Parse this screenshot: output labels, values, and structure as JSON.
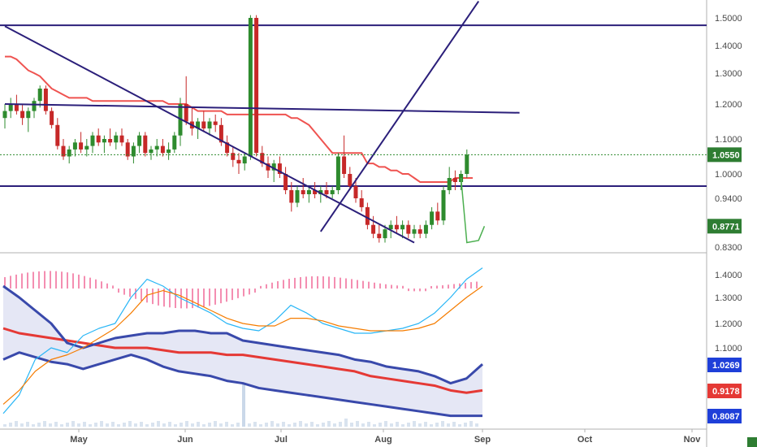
{
  "chart_data": {
    "type": "candlestick",
    "x_tick_labels": [
      "May",
      "Jun",
      "Jul",
      "Aug",
      "Sep",
      "Oct",
      "Nov"
    ],
    "main_panel": {
      "y_tick_labels": [
        "1.5000",
        "1.4000",
        "1.3000",
        "1.2000",
        "1.1000",
        "1.0000",
        "0.9400",
        "0.8300"
      ],
      "last_price": "1.0550",
      "green_line_value": "0.8771",
      "colors": {
        "up": "#2e8b2e",
        "down": "#c62828",
        "line": "#2b1f7a",
        "red_line": "#ef5350",
        "green_line": "#4caf50"
      },
      "series": [
        {
          "name": "",
          "kind": "ohlc",
          "values": [
            {
              "o": 1.16,
              "h": 1.2,
              "l": 1.13,
              "c": 1.18
            },
            {
              "o": 1.18,
              "h": 1.22,
              "l": 1.16,
              "c": 1.2
            },
            {
              "o": 1.2,
              "h": 1.23,
              "l": 1.17,
              "c": 1.18
            },
            {
              "o": 1.18,
              "h": 1.2,
              "l": 1.14,
              "c": 1.16
            },
            {
              "o": 1.16,
              "h": 1.19,
              "l": 1.12,
              "c": 1.18
            },
            {
              "o": 1.18,
              "h": 1.22,
              "l": 1.16,
              "c": 1.21
            },
            {
              "o": 1.21,
              "h": 1.26,
              "l": 1.19,
              "c": 1.25
            },
            {
              "o": 1.25,
              "h": 1.26,
              "l": 1.17,
              "c": 1.18
            },
            {
              "o": 1.18,
              "h": 1.19,
              "l": 1.13,
              "c": 1.14
            },
            {
              "o": 1.14,
              "h": 1.16,
              "l": 1.07,
              "c": 1.08
            },
            {
              "o": 1.08,
              "h": 1.1,
              "l": 1.04,
              "c": 1.05
            },
            {
              "o": 1.05,
              "h": 1.08,
              "l": 1.03,
              "c": 1.07
            },
            {
              "o": 1.07,
              "h": 1.1,
              "l": 1.05,
              "c": 1.09
            },
            {
              "o": 1.09,
              "h": 1.12,
              "l": 1.06,
              "c": 1.07
            },
            {
              "o": 1.07,
              "h": 1.1,
              "l": 1.05,
              "c": 1.08
            },
            {
              "o": 1.08,
              "h": 1.12,
              "l": 1.06,
              "c": 1.11
            },
            {
              "o": 1.11,
              "h": 1.13,
              "l": 1.08,
              "c": 1.09
            },
            {
              "o": 1.09,
              "h": 1.11,
              "l": 1.06,
              "c": 1.1
            },
            {
              "o": 1.1,
              "h": 1.13,
              "l": 1.08,
              "c": 1.09
            },
            {
              "o": 1.09,
              "h": 1.12,
              "l": 1.07,
              "c": 1.11
            },
            {
              "o": 1.11,
              "h": 1.13,
              "l": 1.08,
              "c": 1.09
            },
            {
              "o": 1.09,
              "h": 1.1,
              "l": 1.04,
              "c": 1.05
            },
            {
              "o": 1.05,
              "h": 1.09,
              "l": 1.03,
              "c": 1.08
            },
            {
              "o": 1.08,
              "h": 1.12,
              "l": 1.06,
              "c": 1.11
            },
            {
              "o": 1.11,
              "h": 1.12,
              "l": 1.05,
              "c": 1.06
            },
            {
              "o": 1.06,
              "h": 1.08,
              "l": 1.04,
              "c": 1.07
            },
            {
              "o": 1.07,
              "h": 1.1,
              "l": 1.05,
              "c": 1.08
            },
            {
              "o": 1.08,
              "h": 1.1,
              "l": 1.05,
              "c": 1.06
            },
            {
              "o": 1.06,
              "h": 1.09,
              "l": 1.04,
              "c": 1.07
            },
            {
              "o": 1.07,
              "h": 1.12,
              "l": 1.06,
              "c": 1.11
            },
            {
              "o": 1.11,
              "h": 1.22,
              "l": 1.08,
              "c": 1.2
            },
            {
              "o": 1.2,
              "h": 1.29,
              "l": 1.14,
              "c": 1.15
            },
            {
              "o": 1.15,
              "h": 1.19,
              "l": 1.11,
              "c": 1.13
            },
            {
              "o": 1.13,
              "h": 1.16,
              "l": 1.1,
              "c": 1.15
            },
            {
              "o": 1.15,
              "h": 1.18,
              "l": 1.12,
              "c": 1.13
            },
            {
              "o": 1.13,
              "h": 1.16,
              "l": 1.11,
              "c": 1.15
            },
            {
              "o": 1.15,
              "h": 1.17,
              "l": 1.12,
              "c": 1.14
            },
            {
              "o": 1.14,
              "h": 1.16,
              "l": 1.08,
              "c": 1.09
            },
            {
              "o": 1.09,
              "h": 1.11,
              "l": 1.05,
              "c": 1.06
            },
            {
              "o": 1.06,
              "h": 1.08,
              "l": 1.02,
              "c": 1.04
            },
            {
              "o": 1.04,
              "h": 1.06,
              "l": 1.0,
              "c": 1.03
            },
            {
              "o": 1.03,
              "h": 1.06,
              "l": 1.01,
              "c": 1.05
            },
            {
              "o": 1.05,
              "h": 1.51,
              "l": 1.04,
              "c": 1.5
            },
            {
              "o": 1.5,
              "h": 1.51,
              "l": 1.05,
              "c": 1.06
            },
            {
              "o": 1.06,
              "h": 1.08,
              "l": 1.02,
              "c": 1.03
            },
            {
              "o": 1.03,
              "h": 1.05,
              "l": 0.99,
              "c": 1.01
            },
            {
              "o": 1.01,
              "h": 1.04,
              "l": 0.98,
              "c": 1.03
            },
            {
              "o": 1.03,
              "h": 1.05,
              "l": 0.99,
              "c": 1.0
            },
            {
              "o": 1.0,
              "h": 1.02,
              "l": 0.95,
              "c": 0.96
            },
            {
              "o": 0.96,
              "h": 0.98,
              "l": 0.91,
              "c": 0.93
            },
            {
              "o": 0.93,
              "h": 0.97,
              "l": 0.92,
              "c": 0.96
            },
            {
              "o": 0.96,
              "h": 0.99,
              "l": 0.94,
              "c": 0.95
            },
            {
              "o": 0.95,
              "h": 0.97,
              "l": 0.93,
              "c": 0.96
            },
            {
              "o": 0.96,
              "h": 0.98,
              "l": 0.94,
              "c": 0.95
            },
            {
              "o": 0.95,
              "h": 0.97,
              "l": 0.93,
              "c": 0.96
            },
            {
              "o": 0.96,
              "h": 0.98,
              "l": 0.94,
              "c": 0.95
            },
            {
              "o": 0.95,
              "h": 0.97,
              "l": 0.94,
              "c": 0.96
            },
            {
              "o": 0.96,
              "h": 1.06,
              "l": 0.95,
              "c": 1.05
            },
            {
              "o": 1.05,
              "h": 1.11,
              "l": 0.99,
              "c": 1.0
            },
            {
              "o": 1.0,
              "h": 1.02,
              "l": 0.96,
              "c": 0.97
            },
            {
              "o": 0.97,
              "h": 0.99,
              "l": 0.93,
              "c": 0.94
            },
            {
              "o": 0.94,
              "h": 0.96,
              "l": 0.91,
              "c": 0.92
            },
            {
              "o": 0.92,
              "h": 0.93,
              "l": 0.87,
              "c": 0.88
            },
            {
              "o": 0.88,
              "h": 0.9,
              "l": 0.85,
              "c": 0.86
            },
            {
              "o": 0.86,
              "h": 0.88,
              "l": 0.84,
              "c": 0.85
            },
            {
              "o": 0.85,
              "h": 0.88,
              "l": 0.84,
              "c": 0.87
            },
            {
              "o": 0.87,
              "h": 0.89,
              "l": 0.85,
              "c": 0.88
            },
            {
              "o": 0.88,
              "h": 0.9,
              "l": 0.86,
              "c": 0.87
            },
            {
              "o": 0.87,
              "h": 0.89,
              "l": 0.85,
              "c": 0.88
            },
            {
              "o": 0.88,
              "h": 0.89,
              "l": 0.85,
              "c": 0.86
            },
            {
              "o": 0.86,
              "h": 0.88,
              "l": 0.85,
              "c": 0.87
            },
            {
              "o": 0.87,
              "h": 0.88,
              "l": 0.85,
              "c": 0.86
            },
            {
              "o": 0.86,
              "h": 0.89,
              "l": 0.85,
              "c": 0.88
            },
            {
              "o": 0.88,
              "h": 0.92,
              "l": 0.87,
              "c": 0.91
            },
            {
              "o": 0.91,
              "h": 0.93,
              "l": 0.88,
              "c": 0.89
            },
            {
              "o": 0.89,
              "h": 0.97,
              "l": 0.88,
              "c": 0.96
            },
            {
              "o": 0.96,
              "h": 1.02,
              "l": 0.95,
              "c": 0.99
            },
            {
              "o": 0.99,
              "h": 1.01,
              "l": 0.96,
              "c": 0.98
            },
            {
              "o": 0.98,
              "h": 1.01,
              "l": 0.96,
              "c": 1.0
            },
            {
              "o": 1.0,
              "h": 1.07,
              "l": 0.99,
              "c": 1.055
            }
          ]
        },
        {
          "name": "",
          "kind": "line",
          "color": "#ef5350",
          "values": [
            1.36,
            1.36,
            1.35,
            1.33,
            1.31,
            1.3,
            1.29,
            1.27,
            1.25,
            1.24,
            1.23,
            1.22,
            1.22,
            1.22,
            1.22,
            1.21,
            1.21,
            1.21,
            1.21,
            1.21,
            1.21,
            1.21,
            1.21,
            1.21,
            1.21,
            1.21,
            1.21,
            1.21,
            1.2,
            1.2,
            1.2,
            1.2,
            1.19,
            1.18,
            1.18,
            1.18,
            1.18,
            1.18,
            1.17,
            1.17,
            1.17,
            1.17,
            1.17,
            1.17,
            1.17,
            1.17,
            1.17,
            1.17,
            1.17,
            1.16,
            1.16,
            1.15,
            1.14,
            1.12,
            1.1,
            1.08,
            1.06,
            1.06,
            1.06,
            1.06,
            1.06,
            1.06,
            1.03,
            1.03,
            1.02,
            1.02,
            1.01,
            1.01,
            1.0,
            1.0,
            0.99,
            0.98,
            0.98,
            0.98,
            0.98,
            0.98,
            0.98,
            0.99,
            0.99,
            0.99,
            0.99
          ]
        }
      ],
      "horizontal_lines": [
        1.473,
        0.97
      ],
      "trendlines": [
        {
          "from": [
            0,
            1.2
          ],
          "to": [
            88,
            1.175
          ]
        },
        {
          "from": [
            0,
            1.47
          ],
          "to": [
            70,
            0.84
          ]
        },
        {
          "from": [
            54,
            0.865
          ],
          "to": [
            81,
            1.56
          ]
        }
      ],
      "ylim": [
        0.8,
        1.56
      ]
    },
    "lower_panel": {
      "y_tick_labels": [
        "1.4000",
        "1.3000",
        "1.2000",
        "1.1000",
        "1.0269",
        "0.9178",
        "0.8087"
      ],
      "badges": [
        {
          "label": "1.0269",
          "color": "#1e3fd9"
        },
        {
          "label": "0.9178",
          "color": "#e53935"
        },
        {
          "label": "0.8087",
          "color": "#1e3fd9"
        }
      ],
      "series": [
        {
          "name": "",
          "color": "#e53935",
          "values": [
            1.18,
            1.16,
            1.15,
            1.14,
            1.13,
            1.12,
            1.11,
            1.1,
            1.1,
            1.1,
            1.09,
            1.08,
            1.08,
            1.08,
            1.07,
            1.07,
            1.06,
            1.05,
            1.04,
            1.03,
            1.02,
            1.01,
            1.0,
            0.98,
            0.97,
            0.96,
            0.95,
            0.94,
            0.92,
            0.91,
            0.92
          ]
        },
        {
          "name": "",
          "color": "#3949ab",
          "values": [
            1.35,
            1.3,
            1.25,
            1.2,
            1.12,
            1.1,
            1.12,
            1.14,
            1.15,
            1.16,
            1.16,
            1.17,
            1.17,
            1.16,
            1.16,
            1.13,
            1.12,
            1.11,
            1.1,
            1.09,
            1.08,
            1.07,
            1.05,
            1.04,
            1.02,
            1.01,
            1.0,
            0.98,
            0.95,
            0.97,
            1.03
          ]
        },
        {
          "name": "",
          "color": "#3949ab",
          "values": [
            1.05,
            1.08,
            1.06,
            1.04,
            1.03,
            1.01,
            1.03,
            1.05,
            1.07,
            1.05,
            1.02,
            1.0,
            0.99,
            0.98,
            0.96,
            0.95,
            0.93,
            0.92,
            0.91,
            0.9,
            0.89,
            0.88,
            0.87,
            0.86,
            0.85,
            0.84,
            0.83,
            0.82,
            0.81,
            0.81,
            0.81
          ]
        },
        {
          "name": "",
          "color": "#29b6f6",
          "values": [
            0.82,
            0.9,
            1.05,
            1.1,
            1.08,
            1.15,
            1.18,
            1.2,
            1.3,
            1.38,
            1.35,
            1.3,
            1.27,
            1.24,
            1.2,
            1.18,
            1.17,
            1.21,
            1.27,
            1.24,
            1.2,
            1.18,
            1.16,
            1.16,
            1.17,
            1.18,
            1.2,
            1.24,
            1.3,
            1.38,
            1.43
          ]
        },
        {
          "name": "",
          "color": "#f57c00",
          "values": [
            0.86,
            0.92,
            1.0,
            1.05,
            1.07,
            1.1,
            1.14,
            1.18,
            1.24,
            1.31,
            1.33,
            1.31,
            1.28,
            1.25,
            1.22,
            1.2,
            1.19,
            1.19,
            1.22,
            1.22,
            1.21,
            1.19,
            1.18,
            1.17,
            1.17,
            1.17,
            1.18,
            1.2,
            1.25,
            1.3,
            1.35
          ]
        }
      ],
      "ylim": [
        0.78,
        1.48
      ]
    }
  }
}
